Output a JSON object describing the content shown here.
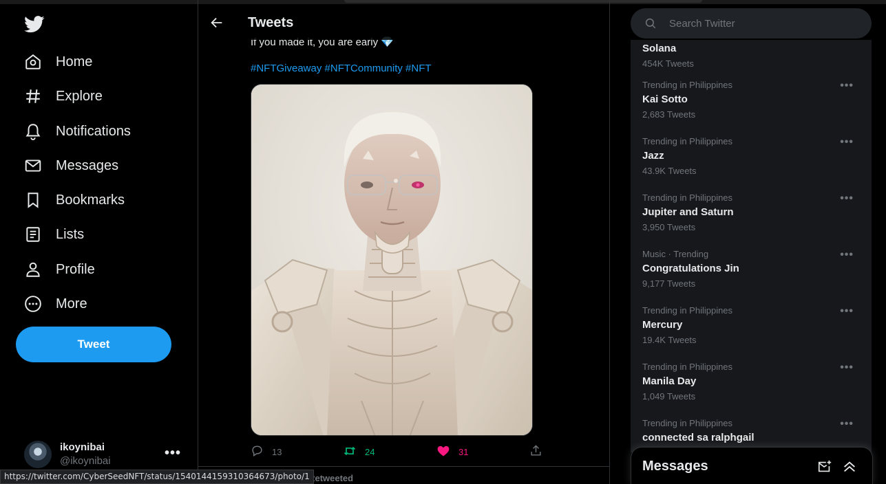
{
  "nav": {
    "items": [
      {
        "label": "Home",
        "icon": "home-icon"
      },
      {
        "label": "Explore",
        "icon": "hashtag-icon"
      },
      {
        "label": "Notifications",
        "icon": "bell-icon"
      },
      {
        "label": "Messages",
        "icon": "envelope-icon"
      },
      {
        "label": "Bookmarks",
        "icon": "bookmark-icon"
      },
      {
        "label": "Lists",
        "icon": "list-icon"
      },
      {
        "label": "Profile",
        "icon": "person-icon"
      },
      {
        "label": "More",
        "icon": "more-circle-icon"
      }
    ],
    "tweet_button": "Tweet"
  },
  "account": {
    "name": "ikoynibai",
    "handle": "@ikoynibai",
    "more": "•••"
  },
  "header": {
    "title": "Tweets"
  },
  "tweet": {
    "text": "If you made it, you are early 💎",
    "hashtags": "#NFTGiveaway #NFTCommunity #NFT",
    "replies": "13",
    "retweets": "24",
    "likes": "31"
  },
  "next_row": {
    "retweeted": "Riders Retweeted"
  },
  "status_bar": {
    "url": "https://twitter.com/CyberSeedNFT/status/1540144159310364673/photo/1"
  },
  "search": {
    "placeholder": "Search Twitter"
  },
  "trends": [
    {
      "context": "",
      "title": "Solana",
      "count": "454K Tweets"
    },
    {
      "context": "Trending in Philippines",
      "title": "Kai Sotto",
      "count": "2,683 Tweets"
    },
    {
      "context": "Trending in Philippines",
      "title": "Jazz",
      "count": "43.9K Tweets"
    },
    {
      "context": "Trending in Philippines",
      "title": "Jupiter and Saturn",
      "count": "3,950 Tweets"
    },
    {
      "context": "Music · Trending",
      "title": "Congratulations Jin",
      "count": "9,177 Tweets"
    },
    {
      "context": "Trending in Philippines",
      "title": "Mercury",
      "count": "19.4K Tweets"
    },
    {
      "context": "Trending in Philippines",
      "title": "Manila Day",
      "count": "1,049 Tweets"
    },
    {
      "context": "Trending in Philippines",
      "title": "connected sa ralphgail",
      "count": ""
    }
  ],
  "messages_drawer": {
    "title": "Messages"
  },
  "colors": {
    "accent": "#1d9bf0",
    "retweet": "#00ba7c",
    "like": "#f91880",
    "background": "#000000",
    "panel": "#16181c"
  }
}
